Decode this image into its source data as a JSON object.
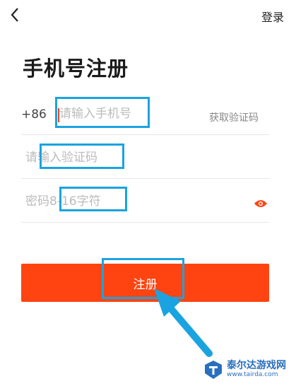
{
  "header": {
    "back_icon": "chevron-left-icon",
    "login_label": "登录"
  },
  "page": {
    "title": "手机号注册"
  },
  "phone_field": {
    "country_code": "+86",
    "placeholder": "请输入手机号",
    "value": "",
    "get_code_label": "获取验证码"
  },
  "code_field": {
    "placeholder": "请输入验证码",
    "value": ""
  },
  "password_field": {
    "placeholder": "密码8-16字符",
    "value": "",
    "toggle_icon": "eye-icon"
  },
  "register_button": {
    "label": "注册"
  },
  "colors": {
    "accent": "#ff4411",
    "highlight": "#1aa3e0",
    "arrow": "#1aa3e0",
    "watermark": "#2a6fbf"
  },
  "watermark": {
    "name": "泰尔达游戏网",
    "url": "www.tairda.com"
  }
}
